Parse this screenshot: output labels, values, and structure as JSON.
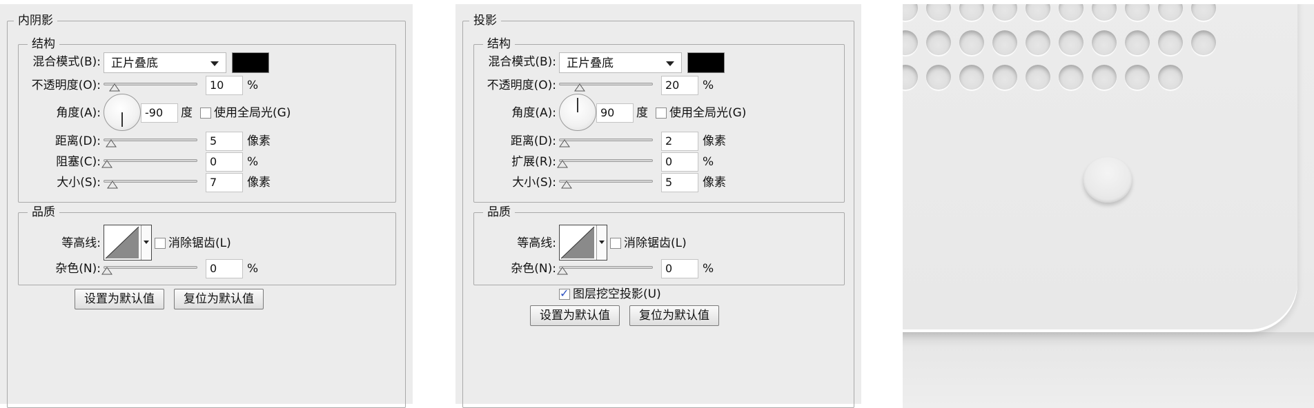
{
  "inner_shadow": {
    "title": "内阴影",
    "structure": {
      "title": "结构",
      "blend_mode_label": "混合模式(B):",
      "blend_mode_value": "正片叠底",
      "blend_color": "#000000",
      "opacity_label": "不透明度(O):",
      "opacity_value": "10",
      "opacity_unit": "%",
      "angle_label": "角度(A):",
      "angle_value": "-90",
      "angle_unit": "度",
      "global_light_label": "使用全局光(G)",
      "global_light_checked": false,
      "distance_label": "距离(D):",
      "distance_value": "5",
      "distance_unit": "像素",
      "choke_label": "阻塞(C):",
      "choke_value": "0",
      "choke_unit": "%",
      "size_label": "大小(S):",
      "size_value": "7",
      "size_unit": "像素"
    },
    "quality": {
      "title": "品质",
      "contour_label": "等高线:",
      "anti_alias_label": "消除锯齿(L)",
      "anti_alias_checked": false,
      "noise_label": "杂色(N):",
      "noise_value": "0",
      "noise_unit": "%"
    },
    "set_default_label": "设置为默认值",
    "reset_default_label": "复位为默认值"
  },
  "drop_shadow": {
    "title": "投影",
    "structure": {
      "title": "结构",
      "blend_mode_label": "混合模式(B):",
      "blend_mode_value": "正片叠底",
      "blend_color": "#000000",
      "opacity_label": "不透明度(O):",
      "opacity_value": "20",
      "opacity_unit": "%",
      "angle_label": "角度(A):",
      "angle_value": "90",
      "angle_unit": "度",
      "global_light_label": "使用全局光(G)",
      "global_light_checked": false,
      "distance_label": "距离(D):",
      "distance_value": "2",
      "distance_unit": "像素",
      "spread_label": "扩展(R):",
      "spread_value": "0",
      "spread_unit": "%",
      "size_label": "大小(S):",
      "size_value": "5",
      "size_unit": "像素"
    },
    "quality": {
      "title": "品质",
      "contour_label": "等高线:",
      "anti_alias_label": "消除锯齿(L)",
      "anti_alias_checked": false,
      "noise_label": "杂色(N):",
      "noise_value": "0",
      "noise_unit": "%"
    },
    "knockout_label": "图层挖空投影(U)",
    "knockout_checked": true,
    "set_default_label": "设置为默认值",
    "reset_default_label": "复位为默认值"
  }
}
